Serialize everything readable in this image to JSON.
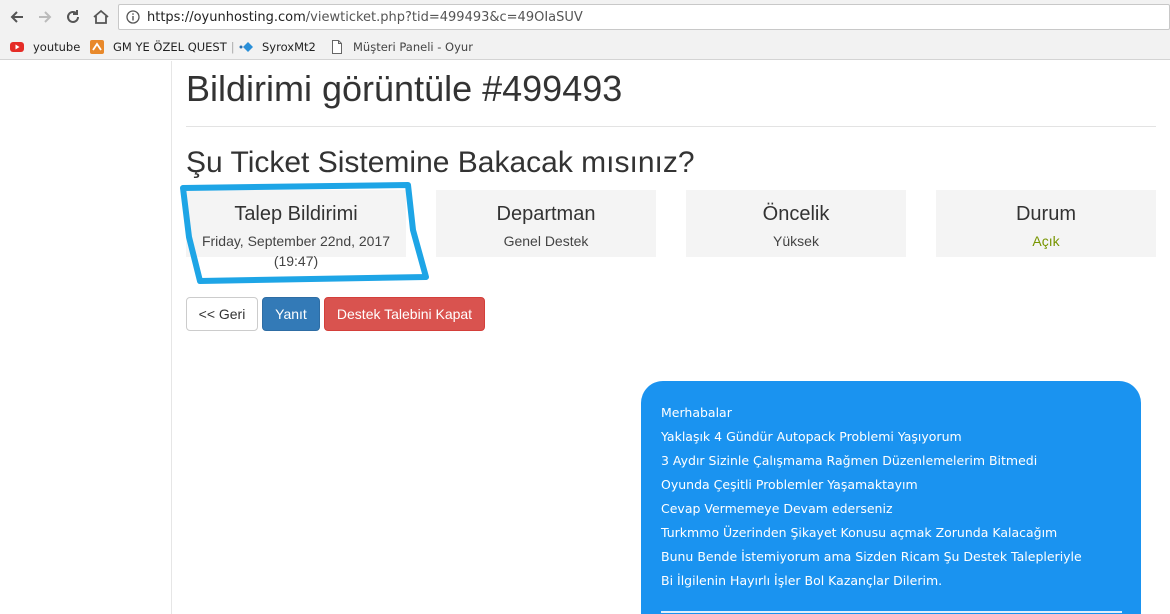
{
  "browser": {
    "url_host": "https://oyunhosting.com",
    "url_path": "/viewticket.php?tid=499493&c=49OIaSUV",
    "bookmarks": [
      {
        "label": "youtube",
        "icon": "youtube-icon"
      },
      {
        "label": "GM YE ÖZEL QUEST",
        "icon": "bookmark-favicon-icon",
        "separator": "|"
      },
      {
        "label": "SyroxMt2",
        "icon": "diamond-icon"
      },
      {
        "label": "Müşteri Paneli - Oyur",
        "icon": "page-icon"
      }
    ]
  },
  "page": {
    "title": "Bildirimi görüntüle #499493",
    "subject": "Şu Ticket Sistemine Bakacak mısınız?"
  },
  "info": {
    "date": {
      "label": "Talep Bildirimi",
      "value": "Friday, September 22nd, 2017",
      "value2": "(19:47)"
    },
    "department": {
      "label": "Departman",
      "value": "Genel Destek"
    },
    "priority": {
      "label": "Öncelik",
      "value": "Yüksek"
    },
    "status": {
      "label": "Durum",
      "value": "Açık"
    }
  },
  "actions": {
    "back": "<< Geri",
    "reply": "Yanıt",
    "close": "Destek Talebini Kapat"
  },
  "message": {
    "lines": [
      "Merhabalar",
      "Yaklaşık 4 Gündür Autopack Problemi Yaşıyorum",
      "3 Aydır Sizinle Çalışmama Rağmen Düzenlemelerim Bitmedi",
      "Oyunda Çeşitli Problemler Yaşamaktayım",
      "Cevap Vermemeye Devam ederseniz",
      "Turkmmo Üzerinden Şikayet Konusu açmak Zorunda Kalacağım",
      "Bunu Bende İstemiyorum ama Sizden Ricam Şu Destek Talepleriyle",
      "Bi İlgilenin Hayırlı İşler Bol Kazançlar Dilerim."
    ]
  },
  "colors": {
    "annotation": "#1ea5e6",
    "reply_button": "#337ab7",
    "close_button": "#d9534f",
    "message_bubble": "#1a93f0",
    "status_open": "#779500"
  }
}
